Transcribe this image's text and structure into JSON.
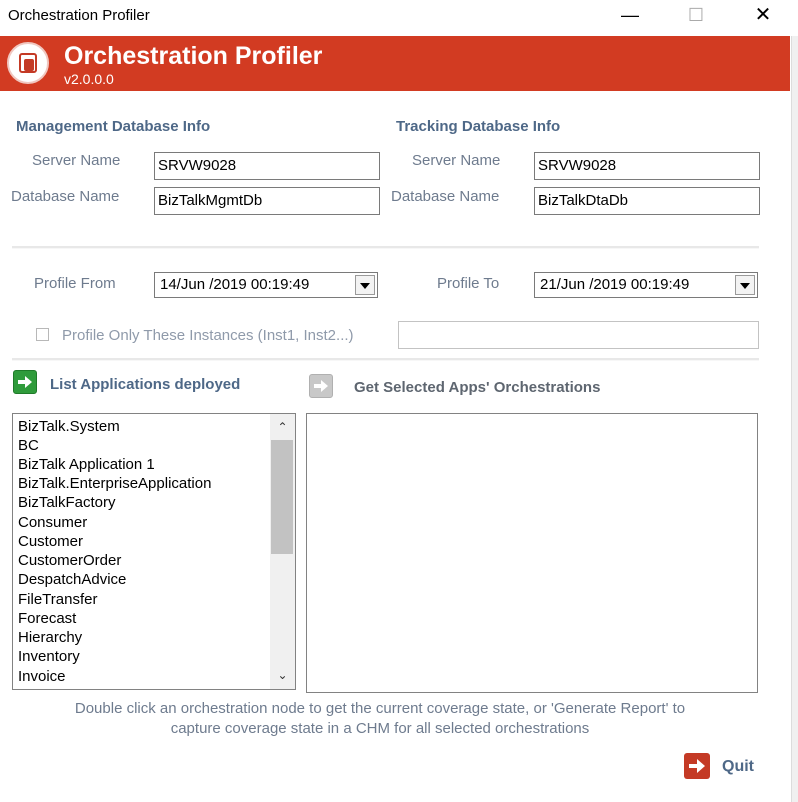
{
  "window": {
    "title": "Orchestration Profiler",
    "minimize_glyph": "—",
    "maximize_glyph": "☐",
    "close_glyph": "✕"
  },
  "banner": {
    "title": "Orchestration Profiler",
    "version": "v2.0.0.0",
    "background": "#d23b22",
    "logo_icon": "orchestration-logo-icon"
  },
  "management": {
    "heading": "Management Database Info",
    "server_label": "Server Name",
    "server_value": "SRVW9028",
    "database_label": "Database Name",
    "database_value": "BizTalkMgmtDb"
  },
  "tracking": {
    "heading": "Tracking Database Info",
    "server_label": "Server Name",
    "server_value": "SRVW9028",
    "database_label": "Database Name",
    "database_value": "BizTalkDtaDb"
  },
  "profile": {
    "from_label": "Profile From",
    "from_value": "14/Jun /2019 00:19:49",
    "to_label": "Profile To",
    "to_value": "21/Jun /2019 00:19:49",
    "instances_label": "Profile Only These Instances (Inst1, Inst2...)",
    "instances_checked": false,
    "instances_value": ""
  },
  "actions": {
    "list_apps_label": "List Applications deployed",
    "list_apps_icon": "green-arrow-right-icon",
    "get_orch_label": "Get Selected Apps' Orchestrations",
    "get_orch_icon": "gray-arrow-right-icon"
  },
  "applications": [
    "BizTalk.System",
    "BC",
    "BizTalk Application 1",
    "BizTalk.EnterpriseApplication",
    "BizTalkFactory",
    "Consumer",
    "Customer",
    "CustomerOrder",
    "DespatchAdvice",
    "FileTransfer",
    "Forecast",
    "Hierarchy",
    "Inventory",
    "Invoice"
  ],
  "hint": {
    "line1": "Double click an orchestration node to get the current coverage state, or 'Generate Report' to",
    "line2": "capture coverage state in a CHM for all selected orchestrations"
  },
  "quit": {
    "label": "Quit",
    "icon": "red-arrow-exit-icon"
  },
  "colors": {
    "heading": "#4e6887",
    "label": "#6e7b8e",
    "accent_red": "#d23b22",
    "green_icon": "#2f9b3b"
  }
}
